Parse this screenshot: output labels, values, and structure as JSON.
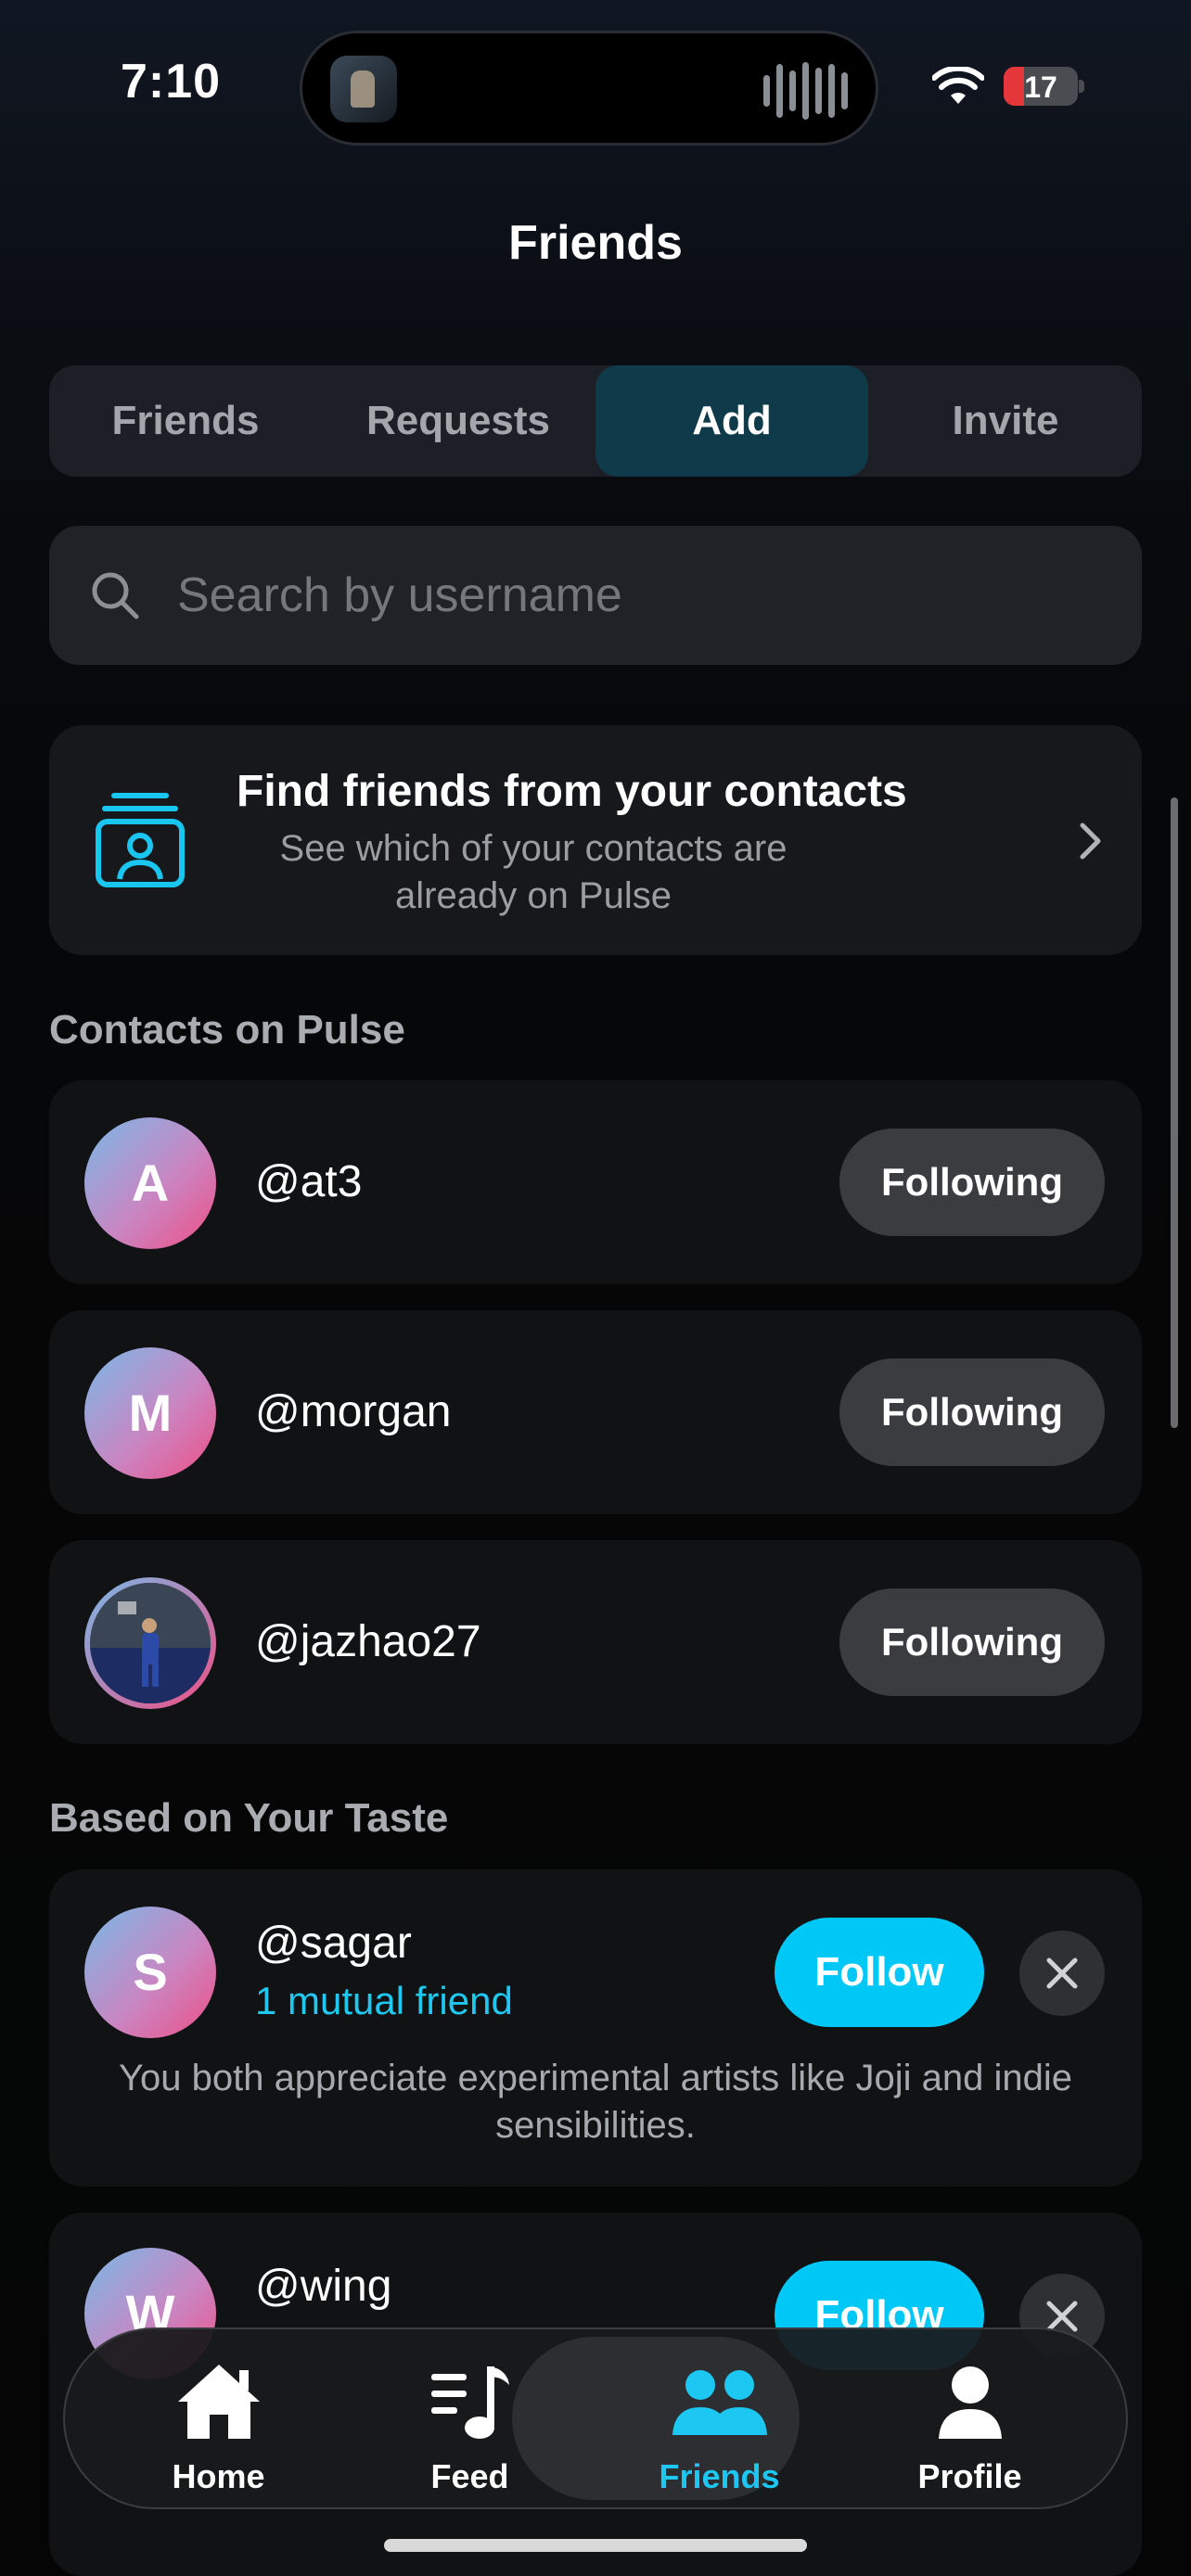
{
  "status_bar": {
    "time": "7:10",
    "battery": "17"
  },
  "header": {
    "title": "Friends"
  },
  "tabs": [
    {
      "label": "Friends",
      "active": false
    },
    {
      "label": "Requests",
      "active": false
    },
    {
      "label": "Add",
      "active": true
    },
    {
      "label": "Invite",
      "active": false
    }
  ],
  "search": {
    "placeholder": "Search by username",
    "icon": "search-icon"
  },
  "contacts_card": {
    "title": "Find friends from your contacts",
    "subtitle": "See which of your contacts are already on Pulse",
    "icon": "contacts-icon"
  },
  "contacts_section": {
    "label": "Contacts on Pulse",
    "items": [
      {
        "initial": "A",
        "username": "@at3",
        "button": "Following"
      },
      {
        "initial": "M",
        "username": "@morgan",
        "button": "Following"
      },
      {
        "initial": "",
        "username": "@jazhao27",
        "button": "Following",
        "photo": true
      }
    ]
  },
  "taste_section": {
    "label": "Based on Your Taste",
    "items": [
      {
        "initial": "S",
        "username": "@sagar",
        "mutual": "1 mutual friend",
        "button": "Follow",
        "reason": "You both appreciate experimental artists like Joji and indie sensibilities."
      },
      {
        "initial": "W",
        "username": "@wing",
        "button": "Follow"
      }
    ]
  },
  "tab_bar": [
    {
      "label": "Home",
      "icon": "home-icon",
      "active": false
    },
    {
      "label": "Feed",
      "icon": "feed-icon",
      "active": false
    },
    {
      "label": "Friends",
      "icon": "friends-icon",
      "active": true
    },
    {
      "label": "Profile",
      "icon": "profile-icon",
      "active": false
    }
  ],
  "colors": {
    "accent": "#00c8f6",
    "active_tab_bg": "#0f3a4a",
    "battery_low": "#e5363a"
  }
}
